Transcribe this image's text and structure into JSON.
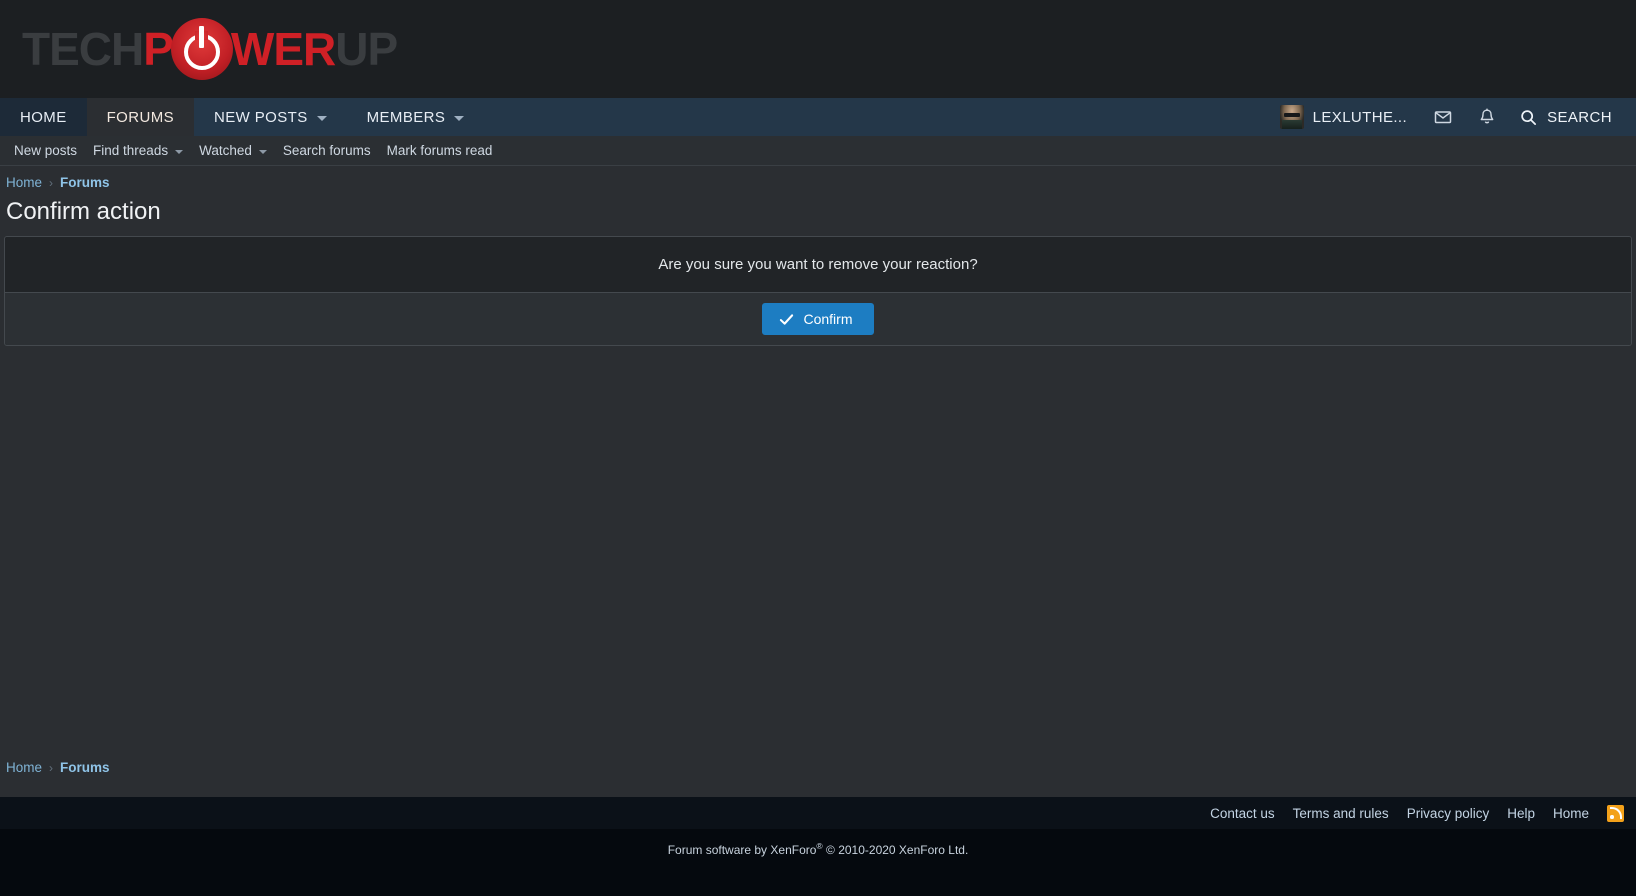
{
  "site": {
    "logo": {
      "part1": "TECH",
      "part2": "P",
      "power_icon": "power-button-icon",
      "part3": "WER",
      "part4": "UP"
    }
  },
  "main_nav": {
    "items": [
      {
        "label": "HOME",
        "has_caret": false,
        "active": false
      },
      {
        "label": "FORUMS",
        "has_caret": false,
        "active": true
      },
      {
        "label": "NEW POSTS",
        "has_caret": true,
        "active": false
      },
      {
        "label": "MEMBERS",
        "has_caret": true,
        "active": false
      }
    ],
    "user": {
      "name": "LEXLUTHE...",
      "avatar": "user-avatar"
    },
    "icons": {
      "inbox": "envelope-icon",
      "alerts": "bell-icon",
      "search": "search-icon"
    },
    "search_label": "SEARCH"
  },
  "sub_nav": {
    "items": [
      {
        "label": "New posts",
        "has_caret": false
      },
      {
        "label": "Find threads",
        "has_caret": true
      },
      {
        "label": "Watched",
        "has_caret": true
      },
      {
        "label": "Search forums",
        "has_caret": false
      },
      {
        "label": "Mark forums read",
        "has_caret": false
      }
    ]
  },
  "breadcrumb": {
    "home": "Home",
    "separator": "›",
    "current": "Forums"
  },
  "page": {
    "title": "Confirm action"
  },
  "confirm_block": {
    "message": "Are you sure you want to remove your reaction?",
    "button_label": "Confirm",
    "button_icon": "check-icon",
    "button_color": "#1d7dc2"
  },
  "footer": {
    "links": [
      "Contact us",
      "Terms and rules",
      "Privacy policy",
      "Help",
      "Home"
    ],
    "rss_icon": "rss-icon",
    "copyright_prefix": "Forum software by XenForo",
    "copyright_sup": "®",
    "copyright_suffix": "© 2010-2020 XenForo Ltd."
  },
  "colors": {
    "page_bg": "#2b2e32",
    "nav_bg": "#243749",
    "accent_red": "#cf2026",
    "link_blue": "#7fb3d5",
    "rss_orange": "#f3a11a"
  }
}
